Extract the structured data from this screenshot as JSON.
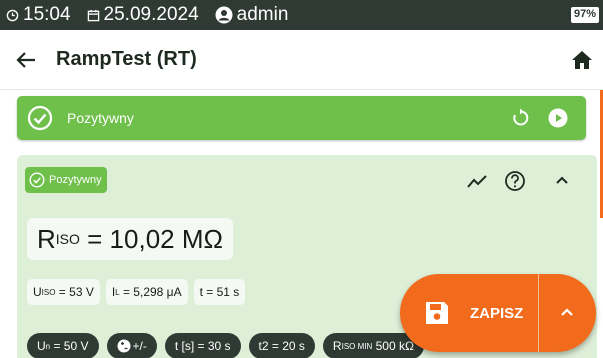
{
  "status_bar": {
    "time": "15:04",
    "date": "25.09.2024",
    "user": "admin",
    "battery": "97%"
  },
  "app_bar": {
    "title": "RampTest (RT)"
  },
  "result_bar": {
    "label": "Pozytywny",
    "color": "#6fbf4b"
  },
  "card": {
    "badge": "Pozytywny",
    "riso": {
      "symbol": "R",
      "sub": "ISO",
      "value": "= 10,02 MΩ"
    },
    "measurements": [
      {
        "symbol": "U",
        "sub": "ISO",
        "value": "= 53 V"
      },
      {
        "symbol": "I",
        "sub": "L",
        "value": "= 5,298 μA"
      },
      {
        "symbol": "",
        "sub": "",
        "value": "t = 51 s"
      }
    ],
    "settings": [
      {
        "symbol": "U",
        "sub": "n",
        "value": "= 50 V"
      },
      {
        "symbol": "",
        "sub": "",
        "value": "+/-"
      },
      {
        "symbol": "",
        "sub": "",
        "value": "t [s] = 30 s"
      },
      {
        "symbol": "",
        "sub": "",
        "value": "t2  = 20 s"
      },
      {
        "symbol": "R",
        "sub": "ISO MIN",
        "value": "500 kΩ"
      }
    ]
  },
  "fab": {
    "save_label": "ZAPISZ",
    "color": "#f26a1b"
  },
  "icons": [
    "clock-icon",
    "calendar-icon",
    "user-icon",
    "battery-icon",
    "back-arrow-icon",
    "home-icon",
    "check-circle-icon",
    "refresh-icon",
    "play-icon",
    "trend-icon",
    "help-icon",
    "chevron-up-icon",
    "save-icon",
    "plus-minus-icon"
  ]
}
